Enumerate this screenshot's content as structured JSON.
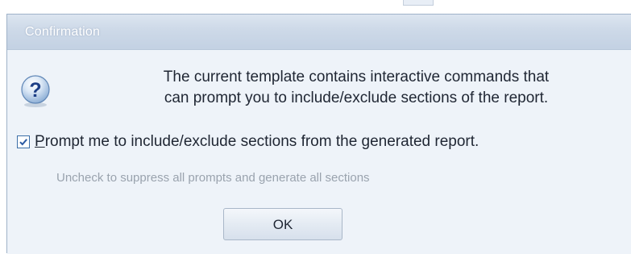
{
  "dialog": {
    "title": "Confirmation",
    "icon": "question-icon",
    "message_lines": [
      "The current template contains interactive commands that",
      "can prompt you to include/exclude sections of the report."
    ],
    "checkbox": {
      "checked": true,
      "label_mnemonic": "P",
      "label_rest": "rompt me to include/exclude sections from the generated report."
    },
    "hint": "Uncheck to suppress all prompts and generate all sections",
    "ok_label": "OK"
  },
  "colors": {
    "title_bar": "#c9d6e7",
    "dialog_background": "#eef3f9",
    "text": "#1f2633",
    "hint_text": "#9aa3ae",
    "checkbox_border": "#3c6fa8"
  }
}
